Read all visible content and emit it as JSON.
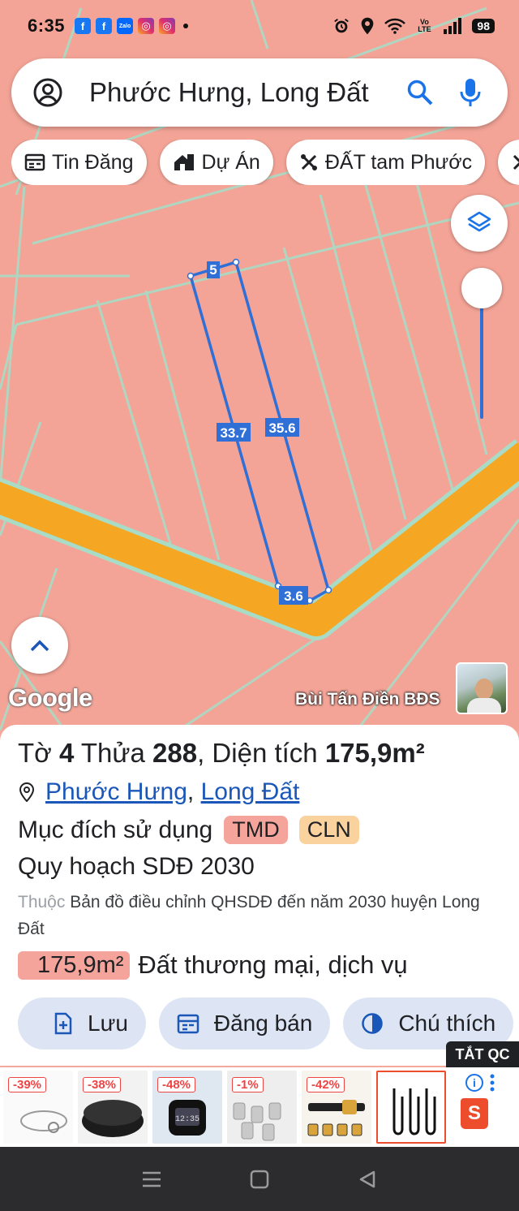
{
  "status_bar": {
    "time": "6:35",
    "notifications": [
      "facebook-icon",
      "facebook-icon",
      "zalo-icon",
      "instagram-icon",
      "instagram-icon"
    ],
    "battery": "98",
    "network": "Vo LTE"
  },
  "search": {
    "query": "Phước Hưng, Long Đất"
  },
  "chips": [
    {
      "label": "Tin Đăng",
      "icon": "newspaper-icon"
    },
    {
      "label": "Dự Án",
      "icon": "building-icon"
    },
    {
      "label": "ĐẤT tam Phước",
      "icon": "tools-icon"
    }
  ],
  "map": {
    "google_logo": "Google",
    "watermark": "Bùi Tấn Điền BĐS",
    "parcel_edges": {
      "top": "5",
      "left": "33.7",
      "right": "35.6",
      "bottom": "3.6"
    },
    "colors": {
      "land": "#f3a497",
      "road": "#f5a623",
      "parcel_outline": "#2f6fd6",
      "plot_lines": "#9ad7c0"
    }
  },
  "info": {
    "title_prefix": "Tờ ",
    "sheet_no": "4",
    "title_mid": " Thửa ",
    "parcel_no": "288",
    "title_area_prefix": ", Diện tích ",
    "area": "175,9m²",
    "location_ward": "Phước Hưng",
    "location_sep": ", ",
    "location_district": "Long Đất",
    "purpose_label": "Mục đích sử dụng",
    "purpose_tags": [
      "TMD",
      "CLN"
    ],
    "plan_title": "Quy hoạch SDĐ 2030",
    "plan_desc_prefix": "Thuộc",
    "plan_desc": " Bản đồ điều chỉnh QHSDĐ đến năm 2030 huyện Long Đất",
    "plan_area": "175,9m²",
    "plan_use": "Đất thương mại, dịch vụ"
  },
  "actions": [
    {
      "label": "Lưu",
      "icon": "save-icon"
    },
    {
      "label": "Đăng bán",
      "icon": "calendar-icon"
    },
    {
      "label": "Chú thích",
      "icon": "contrast-icon"
    }
  ],
  "ads": {
    "close_label": "TẮT QC",
    "discounts": [
      "-39%",
      "-38%",
      "-48%",
      "-1%",
      "-42%"
    ],
    "shop_letter": "S"
  }
}
